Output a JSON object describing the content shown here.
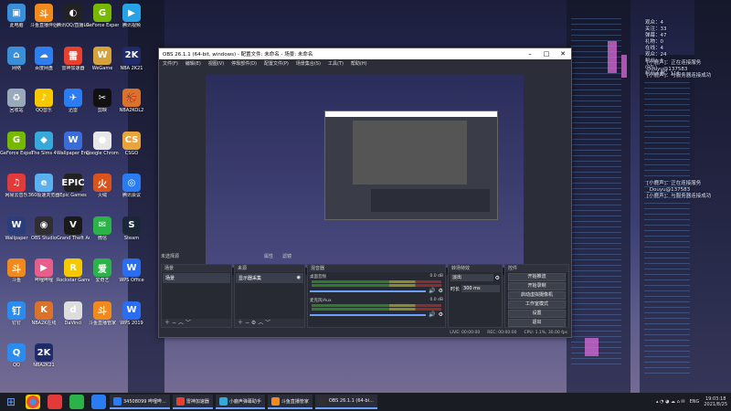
{
  "desktop_icons": [
    {
      "label": "此电脑",
      "color": "#3a8fd9",
      "glyph": "▣"
    },
    {
      "label": "斗鱼直播伴侣",
      "color": "#f08a1c",
      "glyph": "斗"
    },
    {
      "label": "腾讯QQ/直播Lite",
      "color": "#222",
      "glyph": "◐"
    },
    {
      "label": "GeForce Experience",
      "color": "#76b900",
      "glyph": "G"
    },
    {
      "label": "腾讯视频",
      "color": "#29a3e8",
      "glyph": "▶"
    },
    {
      "label": "网络",
      "color": "#3a8fd9",
      "glyph": "⌂"
    },
    {
      "label": "百度网盘",
      "color": "#2e7ef0",
      "glyph": "☁"
    },
    {
      "label": "雷神加速器",
      "color": "#e8402e",
      "glyph": "雷"
    },
    {
      "label": "WeGame",
      "color": "#d6a33a",
      "glyph": "W"
    },
    {
      "label": "NBA 2K21",
      "color": "#1e2a6a",
      "glyph": "2K"
    },
    {
      "label": "回收站",
      "color": "#9ab",
      "glyph": "♻"
    },
    {
      "label": "QQ音乐",
      "color": "#f6c800",
      "glyph": "♪"
    },
    {
      "label": "迅雷",
      "color": "#2b7cf0",
      "glyph": "✈"
    },
    {
      "label": "剪映",
      "color": "#111",
      "glyph": "✂"
    },
    {
      "label": "NBA2KOL2",
      "color": "#d9722a",
      "glyph": "🏀"
    },
    {
      "label": "GeForce Experience",
      "color": "#76b900",
      "glyph": "G"
    },
    {
      "label": "The Sims 4",
      "color": "#36a8d9",
      "glyph": "◆"
    },
    {
      "label": "Wallpaper Engine",
      "color": "#3b6dd9",
      "glyph": "W"
    },
    {
      "label": "Google Chrome",
      "color": "#e7e7e7",
      "glyph": "●"
    },
    {
      "label": "CSGO",
      "color": "#e8a33a",
      "glyph": "CS"
    },
    {
      "label": "网易云音乐",
      "color": "#e23a3a",
      "glyph": "♫"
    },
    {
      "label": "360极速浏览器",
      "color": "#5bb0f0",
      "glyph": "e"
    },
    {
      "label": "Epic Games",
      "color": "#222",
      "glyph": "EPIC"
    },
    {
      "label": "火绒",
      "color": "#d9541c",
      "glyph": "火"
    },
    {
      "label": "腾讯会议",
      "color": "#2b7cf0",
      "glyph": "◎"
    },
    {
      "label": "Wallpaper",
      "color": "#2b3d7a",
      "glyph": "W"
    },
    {
      "label": "OBS Studio",
      "color": "#302e31",
      "glyph": "◉"
    },
    {
      "label": "Grand Theft Auto V",
      "color": "#1a1a1a",
      "glyph": "V"
    },
    {
      "label": "微信",
      "color": "#2bb34a",
      "glyph": "✉"
    },
    {
      "label": "Steam",
      "color": "#1b2838",
      "glyph": "S"
    },
    {
      "label": "斗鱼",
      "color": "#f08a1c",
      "glyph": "斗"
    },
    {
      "label": "哔哩哔哩",
      "color": "#e85d8a",
      "glyph": "▶"
    },
    {
      "label": "Rockstar Games",
      "color": "#f6c800",
      "glyph": "R"
    },
    {
      "label": "爱奇艺",
      "color": "#2bb34a",
      "glyph": "爱"
    },
    {
      "label": "WPS Office",
      "color": "#2b6df0",
      "glyph": "W"
    },
    {
      "label": "钉钉",
      "color": "#2b8cf0",
      "glyph": "钉"
    },
    {
      "label": "NBA2K在线",
      "color": "#d9722a",
      "glyph": "K"
    },
    {
      "label": "DaVinci",
      "color": "#ddd",
      "glyph": "d"
    },
    {
      "label": "斗鱼直播管家",
      "color": "#f08a1c",
      "glyph": "斗"
    },
    {
      "label": "WPS 2019",
      "color": "#2b6df0",
      "glyph": "W"
    },
    {
      "label": "QQ",
      "color": "#2b8cf0",
      "glyph": "Q"
    },
    {
      "label": "NBA2K21",
      "color": "#1e2a6a",
      "glyph": "2K"
    }
  ],
  "overlay_top": [
    "观众：4",
    "关注：33",
    "弹幕：47",
    "礼物：0",
    "在线：4",
    "观众：24",
    "粉丝：1",
    "(0%)",
    "粉丝人数：111"
  ],
  "overlay_mid": [
    "[小鹿声]：正在连接服务",
    "Douyu@137583",
    "[小鹿声]：与服务器连接成功"
  ],
  "overlay_low": [
    "[小鹿声]：正在连接服务",
    "_Douyu@137583",
    "[小鹿声]：与服务器连接成功"
  ],
  "obs": {
    "title": "OBS 26.1.1 (64-bit, windows) - 配置文件: 未命名 - 场景: 未命名",
    "menu": [
      "文件(F)",
      "编辑(E)",
      "视图(V)",
      "停靠部件(D)",
      "配置文件(P)",
      "场景集合(S)",
      "工具(T)",
      "帮助(H)"
    ],
    "preview_label": "未选择源",
    "tabs": {
      "properties": "属性",
      "filters": "滤镜"
    },
    "docks": {
      "scenes": {
        "title": "场景",
        "items": [
          "场景"
        ]
      },
      "sources": {
        "title": "来源",
        "items": [
          "显示器采集"
        ]
      },
      "mixer": {
        "title": "混音器",
        "channels": [
          {
            "name": "桌面音频",
            "db": "0.0 dB"
          },
          {
            "name": "麦克风/Aux",
            "db": "0.0 dB"
          }
        ]
      },
      "transitions": {
        "title": "转场特效",
        "type": "淡出",
        "duration_label": "时长",
        "duration": "300 ms"
      },
      "controls": {
        "title": "控件",
        "buttons": [
          "开始推流",
          "开始录制",
          "启动虚拟摄像机",
          "工作室模式",
          "设置",
          "退出"
        ]
      }
    },
    "status": [
      "LIVE: 00:00:00",
      "REC: 00:00:00",
      "CPU: 1.1%, 30.00 fps"
    ]
  },
  "taskbar": {
    "apps": [
      {
        "label": "34508099 哔哩哔...",
        "color": "#2b7cf0"
      },
      {
        "label": "雷神加速器",
        "color": "#e8402e"
      },
      {
        "label": "小鹿声弹幕助手",
        "color": "#36a8d9"
      },
      {
        "label": "斗鱼直播管家",
        "color": "#f08a1c"
      },
      {
        "label": "OBS 26.1.1 (64-bi...",
        "color": "#302e31"
      }
    ],
    "lang": "ENG",
    "time": "19:03:18",
    "date": "2021/8/25"
  }
}
